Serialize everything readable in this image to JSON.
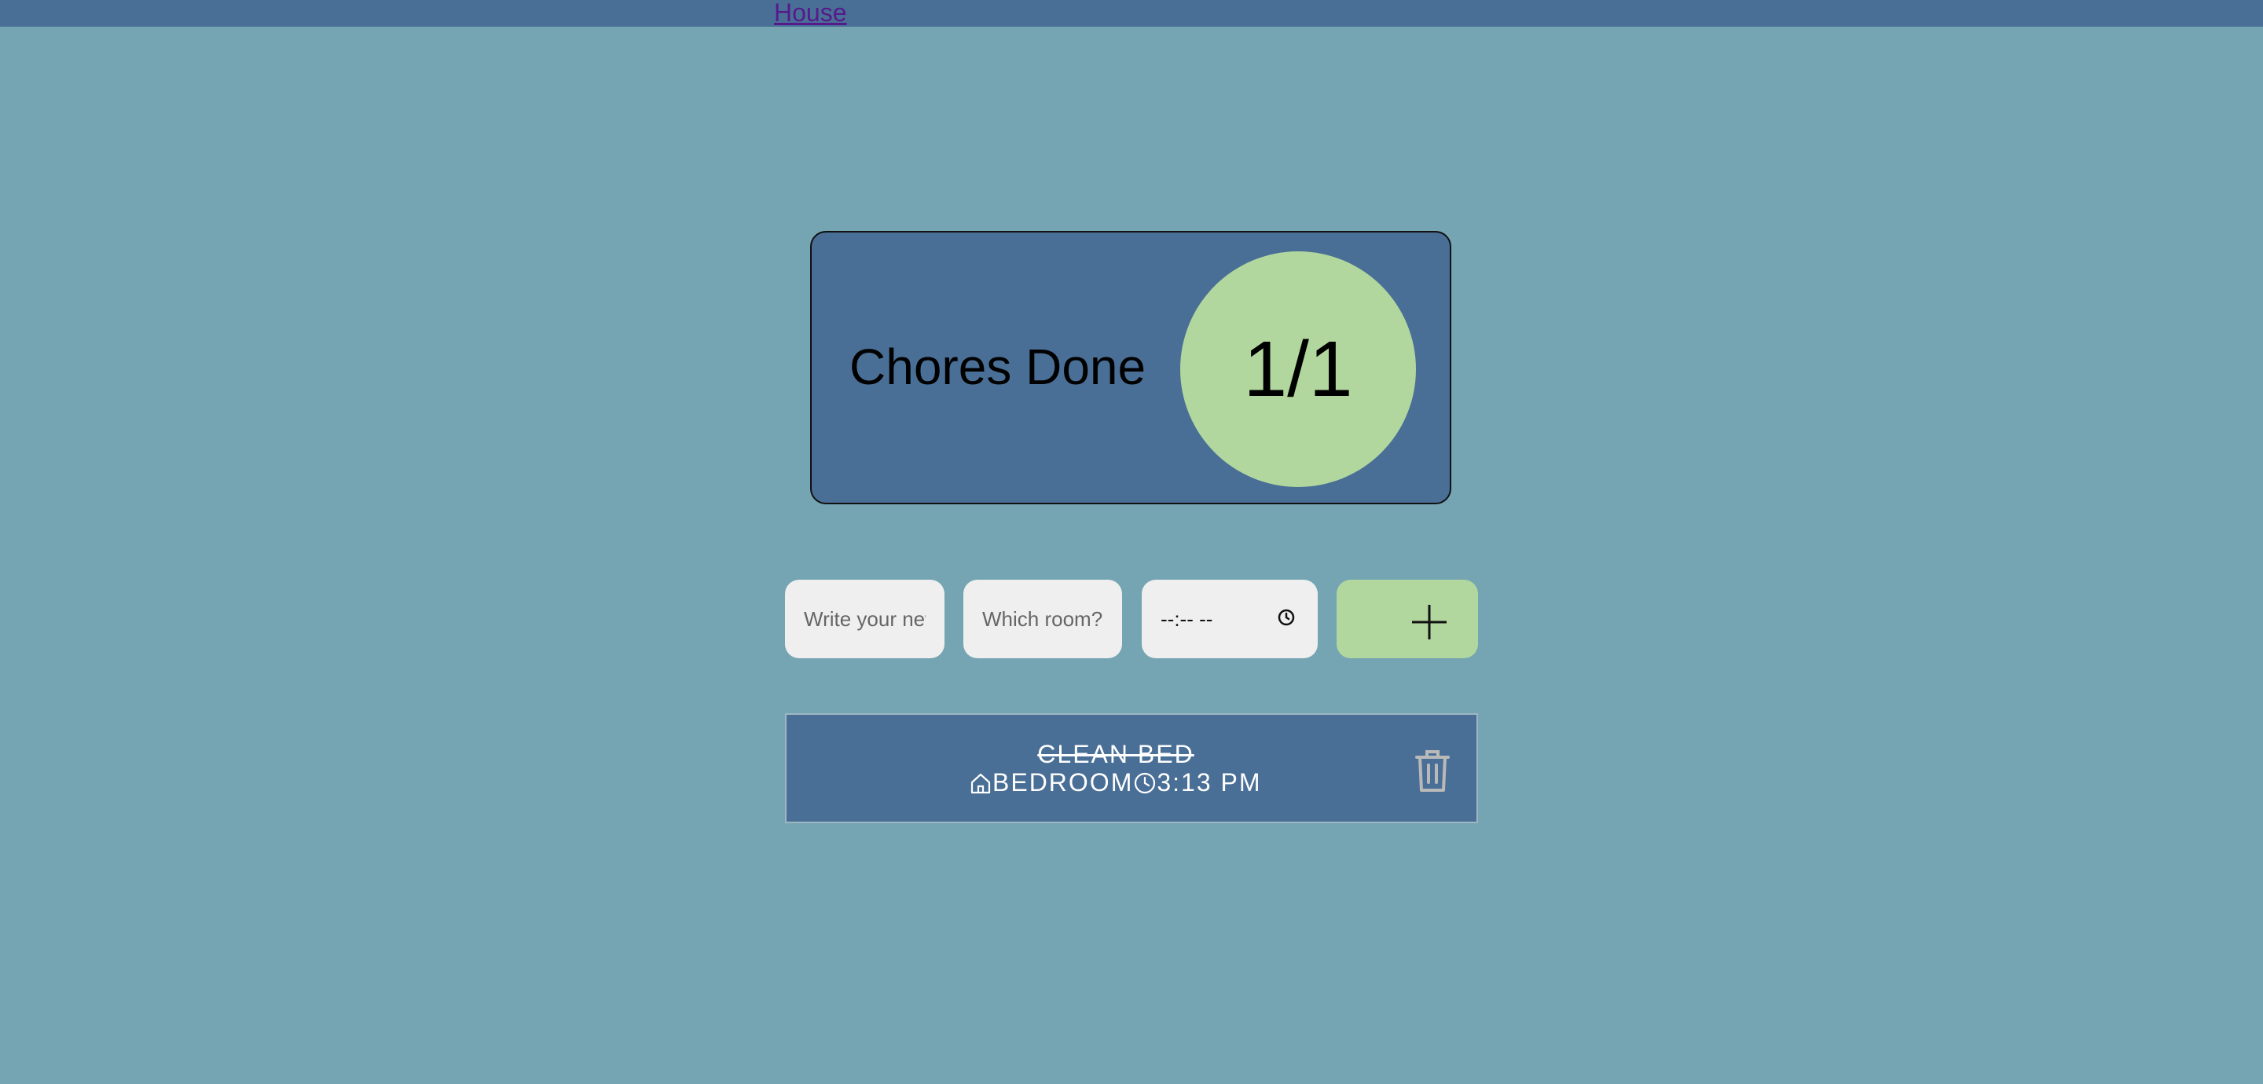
{
  "nav": {
    "link_label": "House"
  },
  "summary": {
    "title": "Chores Done",
    "progress": "1/1"
  },
  "form": {
    "name_placeholder": "Write your new chore",
    "room_placeholder": "Which room?",
    "time_value": "--:-- --",
    "add_icon": "plus-icon"
  },
  "chores": [
    {
      "title": "CLEAN BED",
      "room": "BEDROOM",
      "time": "3:13 PM",
      "done": true
    }
  ],
  "colors": {
    "background": "#75a5b3",
    "panel": "#4a6f96",
    "accent": "#b2d79e"
  }
}
